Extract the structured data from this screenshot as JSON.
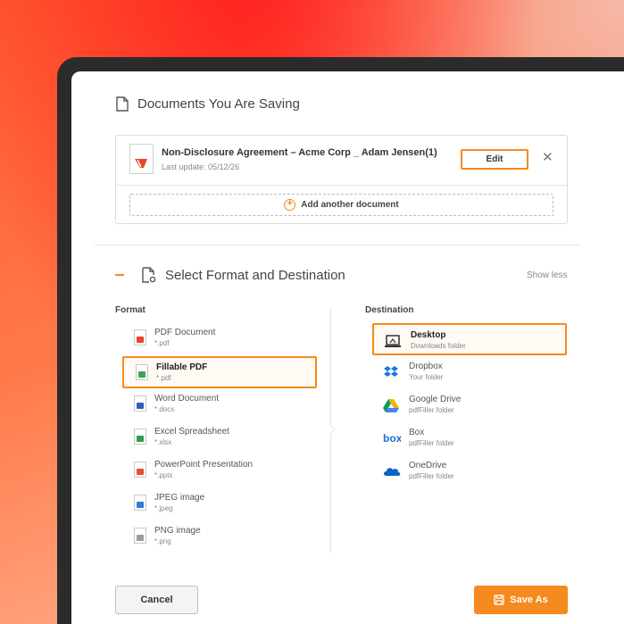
{
  "saving": {
    "title": "Documents You Are Saving",
    "document": {
      "name": "Non-Disclosure Agreement – Acme Corp _ Adam Jensen(1)",
      "last_update": "Last update: 05/12/26",
      "edit_label": "Edit",
      "close_symbol": "✕"
    },
    "add_label": "Add another document"
  },
  "format_section": {
    "title": "Select Format and Destination",
    "show_less": "Show less",
    "format_header": "Format",
    "destination_header": "Destination"
  },
  "formats": [
    {
      "name": "PDF Document",
      "ext": "*.pdf",
      "icon": "pdf-icon",
      "color": "#e8452c"
    },
    {
      "name": "Fillable PDF",
      "ext": "*.pdf",
      "icon": "fillable-pdf-icon",
      "color": "#3aa55a",
      "selected": true
    },
    {
      "name": "Word Document",
      "ext": "*.docx",
      "icon": "word-icon",
      "color": "#2f5fb3"
    },
    {
      "name": "Excel Spreadsheet",
      "ext": "*.xlsx",
      "icon": "excel-icon",
      "color": "#2e9e4e"
    },
    {
      "name": "PowerPoint Presentation",
      "ext": "*.pptx",
      "icon": "powerpoint-icon",
      "color": "#e0502a"
    },
    {
      "name": "JPEG image",
      "ext": "*.jpeg",
      "icon": "jpeg-icon",
      "color": "#2f7fd0"
    },
    {
      "name": "PNG image",
      "ext": "*.png",
      "icon": "png-icon",
      "color": "#9a9a9a"
    }
  ],
  "destinations": [
    {
      "name": "Desktop",
      "sub": "Downloads folder",
      "icon": "laptop-icon",
      "selected": true
    },
    {
      "name": "Dropbox",
      "sub": "Your folder",
      "icon": "dropbox-icon"
    },
    {
      "name": "Google Drive",
      "sub": "pdfFiller folder",
      "icon": "google-drive-icon"
    },
    {
      "name": "Box",
      "sub": "pdfFiller folder",
      "icon": "box-icon"
    },
    {
      "name": "OneDrive",
      "sub": "pdfFiller folder",
      "icon": "onedrive-icon"
    }
  ],
  "footer": {
    "cancel_label": "Cancel",
    "save_label": "Save As"
  },
  "colors": {
    "accent": "#f58a1f"
  }
}
